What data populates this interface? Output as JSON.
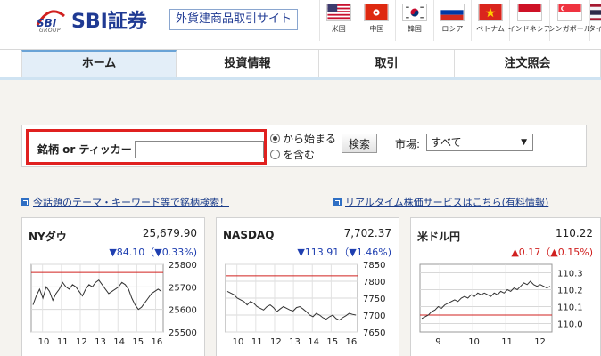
{
  "header": {
    "logo_mark": "SBI",
    "logo_group": "GROUP",
    "logo_text": "SBI証券",
    "sub_title": "外貨建商品取引サイト"
  },
  "flags": [
    {
      "label": "米国",
      "icon": "us-flag-icon"
    },
    {
      "label": "中国",
      "icon": "hong-kong-flag-icon"
    },
    {
      "label": "韓国",
      "icon": "korea-flag-icon"
    },
    {
      "label": "ロシア",
      "icon": "russia-flag-icon"
    },
    {
      "label": "ベトナム",
      "icon": "vietnam-flag-icon"
    },
    {
      "label": "インドネシア",
      "icon": "indonesia-flag-icon"
    },
    {
      "label": "シンガポール",
      "icon": "singapore-flag-icon"
    },
    {
      "label": "タイ",
      "icon": "thailand-flag-icon"
    }
  ],
  "nav": [
    {
      "label": "ホーム",
      "active": true
    },
    {
      "label": "投資情報"
    },
    {
      "label": "取引"
    },
    {
      "label": "注文照会"
    }
  ],
  "search": {
    "label": "銘柄 or ティッカー",
    "input_value": "",
    "radio_starts_with": "から始まる",
    "radio_contains": "を含む",
    "button_label": "検索",
    "market_label": "市場:",
    "market_selected": "すべて"
  },
  "links": {
    "theme_search": "今話題のテーマ・キーワード等で銘柄検索！",
    "realtime": "リアルタイム株価サービスはこちら(有料情報)"
  },
  "colors": {
    "brand": "#1f3a93",
    "highlight": "#e0201f",
    "down": "#1f3fb0",
    "up": "#d0201f"
  },
  "cards": [
    {
      "name": "NYダウ",
      "value": "25,679.90",
      "change": "▼84.10（▼0.33%)",
      "direction": "down",
      "chart_data": {
        "type": "line",
        "x_ticks": [
          "10",
          "11",
          "12",
          "13",
          "14",
          "15",
          "16"
        ],
        "y_ticks": [
          "25800",
          "25700",
          "25600",
          "25500"
        ],
        "ylim": [
          25500,
          25800
        ],
        "reference": 25764,
        "values": [
          25620,
          25660,
          25690,
          25650,
          25700,
          25680,
          25640,
          25670,
          25690,
          25720,
          25700,
          25690,
          25710,
          25700,
          25680,
          25660,
          25690,
          25710,
          25700,
          25720,
          25730,
          25710,
          25690,
          25670,
          25680,
          25690,
          25700,
          25720,
          25710,
          25690,
          25650,
          25620,
          25600,
          25610,
          25630,
          25650,
          25670,
          25680,
          25690,
          25680
        ]
      }
    },
    {
      "name": "NASDAQ",
      "value": "7,702.37",
      "change": "▼113.91（▼1.46%)",
      "direction": "down",
      "chart_data": {
        "type": "line",
        "x_ticks": [
          "10",
          "11",
          "12",
          "13",
          "14",
          "15",
          "16"
        ],
        "y_ticks": [
          "7850",
          "7800",
          "7750",
          "7700",
          "7650"
        ],
        "ylim": [
          7650,
          7850
        ],
        "reference": 7816,
        "values": [
          7770,
          7765,
          7760,
          7750,
          7745,
          7740,
          7730,
          7740,
          7735,
          7725,
          7720,
          7715,
          7725,
          7730,
          7722,
          7710,
          7718,
          7725,
          7720,
          7715,
          7712,
          7722,
          7725,
          7718,
          7710,
          7700,
          7695,
          7705,
          7700,
          7692,
          7688,
          7695,
          7700,
          7690,
          7685,
          7692,
          7698,
          7705,
          7702,
          7700
        ]
      }
    },
    {
      "name": "米ドル円",
      "value": "110.22",
      "change": "▲0.17（▲0.15%)",
      "direction": "up",
      "chart_data": {
        "type": "line",
        "x_ticks": [
          "9",
          "10",
          "11",
          "12"
        ],
        "y_ticks": [
          "110.3",
          "110.2",
          "110.1",
          "110.0"
        ],
        "ylim": [
          109.95,
          110.35
        ],
        "reference": 110.05,
        "values": [
          110.03,
          110.04,
          110.05,
          110.07,
          110.08,
          110.1,
          110.09,
          110.11,
          110.12,
          110.13,
          110.14,
          110.13,
          110.15,
          110.16,
          110.15,
          110.17,
          110.16,
          110.18,
          110.17,
          110.18,
          110.17,
          110.16,
          110.18,
          110.17,
          110.19,
          110.18,
          110.2,
          110.19,
          110.21,
          110.2,
          110.22,
          110.24,
          110.23,
          110.25,
          110.23,
          110.22,
          110.23,
          110.22,
          110.21,
          110.22
        ]
      }
    }
  ]
}
